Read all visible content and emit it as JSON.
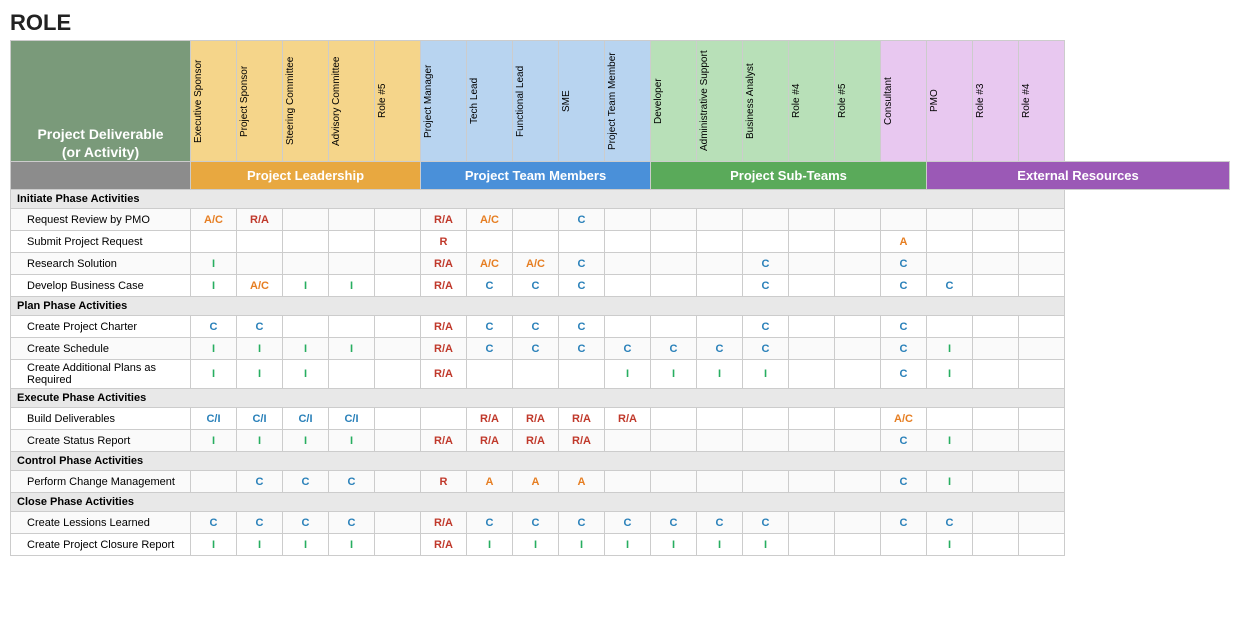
{
  "title": "ROLE",
  "activityHeader": "Project Deliverable\n(or Activity)",
  "groupHeaders": [
    {
      "label": "Project Leadership",
      "span": 5,
      "class": "gh-leadership"
    },
    {
      "label": "Project Team Members",
      "span": 5,
      "class": "gh-team"
    },
    {
      "label": "Project Sub-Teams",
      "span": 6,
      "class": "gh-subteam"
    },
    {
      "label": "External Resources",
      "span": 4,
      "class": "gh-external"
    }
  ],
  "roles": [
    {
      "label": "Executive Sponsor",
      "band": "band-leadership"
    },
    {
      "label": "Project Sponsor",
      "band": "band-leadership"
    },
    {
      "label": "Steering Committee",
      "band": "band-leadership"
    },
    {
      "label": "Advisory Committee",
      "band": "band-leadership"
    },
    {
      "label": "Role #5",
      "band": "band-leadership"
    },
    {
      "label": "Project Manager",
      "band": "band-team"
    },
    {
      "label": "Tech Lead",
      "band": "band-team"
    },
    {
      "label": "Functional Lead",
      "band": "band-team"
    },
    {
      "label": "SME",
      "band": "band-team"
    },
    {
      "label": "Project Team Member",
      "band": "band-team"
    },
    {
      "label": "Developer",
      "band": "band-subteam"
    },
    {
      "label": "Administrative Support",
      "band": "band-subteam"
    },
    {
      "label": "Business Analyst",
      "band": "band-subteam"
    },
    {
      "label": "Role #4",
      "band": "band-subteam"
    },
    {
      "label": "Role #5",
      "band": "band-subteam"
    },
    {
      "label": "Consultant",
      "band": "band-external"
    },
    {
      "label": "PMO",
      "band": "band-external"
    },
    {
      "label": "Role #3",
      "band": "band-external"
    },
    {
      "label": "Role #4",
      "band": "band-external"
    }
  ],
  "rows": [
    {
      "type": "phase",
      "label": "Initiate Phase Activities",
      "cells": [
        "",
        "",
        "",
        "",
        "",
        "",
        "",
        "",
        "",
        "",
        "",
        "",
        "",
        "",
        "",
        "",
        "",
        "",
        ""
      ]
    },
    {
      "type": "data",
      "label": "Request Review by PMO",
      "cells": [
        "A/C",
        "R/A",
        "",
        "",
        "",
        "R/A",
        "A/C",
        "",
        "C",
        "",
        "",
        "",
        "",
        "",
        "",
        "",
        "",
        "",
        ""
      ]
    },
    {
      "type": "data",
      "label": "Submit Project Request",
      "cells": [
        "",
        "",
        "",
        "",
        "",
        "R",
        "",
        "",
        "",
        "",
        "",
        "",
        "",
        "",
        "",
        "A",
        "",
        "",
        ""
      ]
    },
    {
      "type": "data",
      "label": "Research Solution",
      "cells": [
        "I",
        "",
        "",
        "",
        "",
        "R/A",
        "A/C",
        "A/C",
        "C",
        "",
        "",
        "",
        "C",
        "",
        "",
        "C",
        "",
        "",
        ""
      ]
    },
    {
      "type": "data",
      "label": "Develop Business Case",
      "cells": [
        "I",
        "A/C",
        "I",
        "I",
        "",
        "R/A",
        "C",
        "C",
        "C",
        "",
        "",
        "",
        "C",
        "",
        "",
        "C",
        "C",
        "",
        ""
      ]
    },
    {
      "type": "phase",
      "label": "Plan Phase Activities",
      "cells": [
        "",
        "",
        "",
        "",
        "",
        "",
        "",
        "",
        "",
        "",
        "",
        "",
        "",
        "",
        "",
        "",
        "",
        "",
        ""
      ]
    },
    {
      "type": "data",
      "label": "Create Project Charter",
      "cells": [
        "C",
        "C",
        "",
        "",
        "",
        "R/A",
        "C",
        "C",
        "C",
        "",
        "",
        "",
        "C",
        "",
        "",
        "C",
        "",
        "",
        ""
      ]
    },
    {
      "type": "data",
      "label": "Create Schedule",
      "cells": [
        "I",
        "I",
        "I",
        "I",
        "",
        "R/A",
        "C",
        "C",
        "C",
        "C",
        "C",
        "C",
        "C",
        "",
        "",
        "C",
        "I",
        "",
        ""
      ]
    },
    {
      "type": "data",
      "label": "Create Additional Plans as Required",
      "cells": [
        "I",
        "I",
        "I",
        "",
        "",
        "R/A",
        "",
        "",
        "",
        "I",
        "I",
        "I",
        "I",
        "",
        "",
        "C",
        "I",
        "",
        ""
      ]
    },
    {
      "type": "phase",
      "label": "Execute Phase Activities",
      "cells": [
        "",
        "",
        "",
        "",
        "",
        "",
        "",
        "",
        "",
        "",
        "",
        "",
        "",
        "",
        "",
        "",
        "",
        "",
        ""
      ]
    },
    {
      "type": "data",
      "label": "Build Deliverables",
      "cells": [
        "C/I",
        "C/I",
        "C/I",
        "C/I",
        "",
        "",
        "R/A",
        "R/A",
        "R/A",
        "R/A",
        "",
        "",
        "",
        "",
        "",
        "A/C",
        "",
        "",
        ""
      ]
    },
    {
      "type": "data",
      "label": "Create Status Report",
      "cells": [
        "I",
        "I",
        "I",
        "I",
        "",
        "R/A",
        "R/A",
        "R/A",
        "R/A",
        "",
        "",
        "",
        "",
        "",
        "",
        "C",
        "I",
        "",
        ""
      ]
    },
    {
      "type": "phase",
      "label": "Control Phase Activities",
      "cells": [
        "",
        "",
        "",
        "",
        "",
        "",
        "",
        "",
        "",
        "",
        "",
        "",
        "",
        "",
        "",
        "",
        "",
        "",
        ""
      ]
    },
    {
      "type": "data",
      "label": "Perform Change Management",
      "cells": [
        "",
        "C",
        "C",
        "C",
        "",
        "R",
        "A",
        "A",
        "A",
        "",
        "",
        "",
        "",
        "",
        "",
        "C",
        "I",
        "",
        ""
      ]
    },
    {
      "type": "phase",
      "label": "Close Phase Activities",
      "cells": [
        "",
        "",
        "",
        "",
        "",
        "",
        "",
        "",
        "",
        "",
        "",
        "",
        "",
        "",
        "",
        "",
        "",
        "",
        ""
      ]
    },
    {
      "type": "data",
      "label": "Create Lessions Learned",
      "cells": [
        "C",
        "C",
        "C",
        "C",
        "",
        "R/A",
        "C",
        "C",
        "C",
        "C",
        "C",
        "C",
        "C",
        "",
        "",
        "C",
        "C",
        "",
        ""
      ]
    },
    {
      "type": "data",
      "label": "Create Project Closure Report",
      "cells": [
        "I",
        "I",
        "I",
        "I",
        "",
        "R/A",
        "I",
        "I",
        "I",
        "I",
        "I",
        "I",
        "I",
        "",
        "",
        "",
        "I",
        "",
        ""
      ]
    }
  ]
}
